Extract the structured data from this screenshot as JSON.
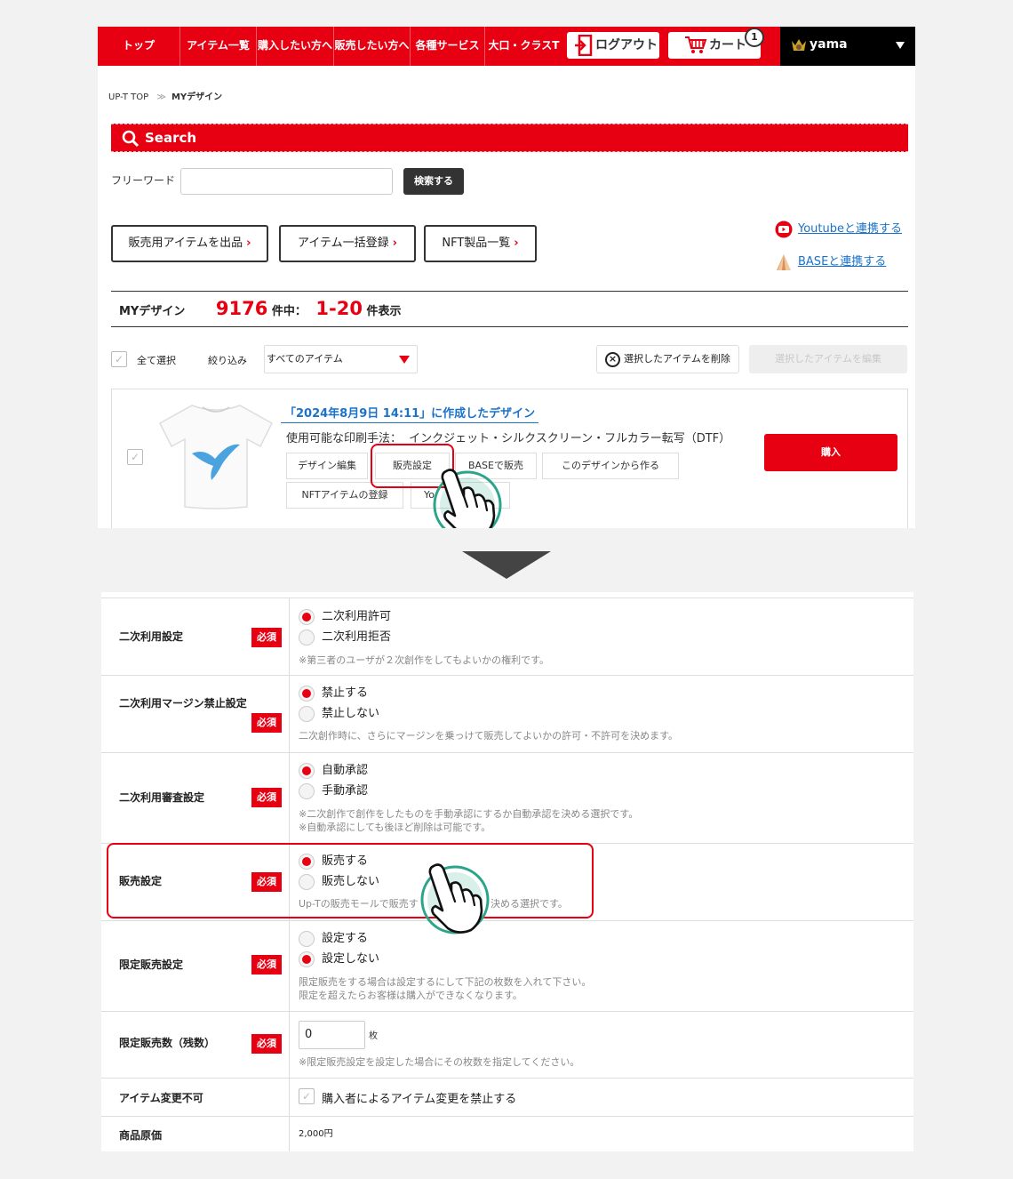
{
  "nav": {
    "items": [
      "トップ",
      "アイテム一覧",
      "購入したい方へ",
      "販売したい方へ",
      "各種サービス",
      "大口・クラスT"
    ],
    "logout_label": "ログアウト",
    "cart_label": "カート",
    "cart_count": "1",
    "username": "yama"
  },
  "breadcrumb": {
    "root": "UP-T TOP",
    "current": "MYデザイン"
  },
  "search": {
    "title": "Search",
    "freeword_label": "フリーワード",
    "freeword_value": "",
    "submit_label": "検索する"
  },
  "actions": [
    "販売用アイテムを出品",
    "アイテム一括登録",
    "NFT製品一覧"
  ],
  "links": {
    "youtube": "Youtubeと連携する",
    "base": "BASEと連携する"
  },
  "summary": {
    "title": "MYデザイン",
    "total": "9176",
    "total_suffix": "件中：",
    "range": "1-20",
    "range_suffix": "件表示"
  },
  "filters": {
    "select_all_label": "全て選択",
    "narrow_label": "絞り込み",
    "narrow_value": "すべてのアイテム",
    "delete_selected_label": "選択したアイテムを削除",
    "edit_selected_label": "選択したアイテムを編集"
  },
  "item": {
    "title": "「2024年8月9日 14:11」に作成したデザイン",
    "print_methods_label": "使用可能な印刷手法：",
    "print_methods": "インクジェット・シルクスクリーン・フルカラー転写（DTF）",
    "buttons": [
      "デザイン編集",
      "販売設定",
      "BASEで販売",
      "このデザインから作る",
      "NFTアイテムの登録",
      "Yo"
    ],
    "buy_label": "購入"
  },
  "form": {
    "required_label": "必須",
    "rows": [
      {
        "label": "二次利用設定",
        "options": [
          "二次利用許可",
          "二次利用拒否"
        ],
        "selected": 0,
        "notes": [
          "※第三者のユーザが２次創作をしてもよいかの権利です。"
        ]
      },
      {
        "label": "二次利用マージン禁止設定",
        "options": [
          "禁止する",
          "禁止しない"
        ],
        "selected": 0,
        "notes": [
          "二次創作時に、さらにマージンを乗っけて販売してよいかの許可・不許可を決めます。"
        ]
      },
      {
        "label": "二次利用審査設定",
        "options": [
          "自動承認",
          "手動承認"
        ],
        "selected": 0,
        "notes": [
          "※二次創作で創作をしたものを手動承認にするか自動承認を決める選択です。",
          "※自動承認にしても後ほど削除は可能です。"
        ]
      },
      {
        "label": "販売設定",
        "options": [
          "販売する",
          "販売しない"
        ],
        "selected": 0,
        "notes": [
          "Up-Tの販売モールで販売す",
          "決める選択です。"
        ]
      },
      {
        "label": "限定販売設定",
        "options": [
          "設定する",
          "設定しない"
        ],
        "selected": 1,
        "notes": [
          "限定販売をする場合は設定するにして下記の枚数を入れて下さい。",
          "限定を超えたらお客様は購入ができなくなります。"
        ]
      }
    ],
    "limit_count": {
      "label": "限定販売数（残数）",
      "value": "0",
      "unit": "枚",
      "note": "※限定販売設定を設定した場合にその枚数を指定してください。"
    },
    "no_change": {
      "label": "アイテム変更不可",
      "checkbox_label": "購入者によるアイテム変更を禁止する"
    },
    "cost": {
      "label": "商品原価",
      "value": "2,000円"
    }
  },
  "colors": {
    "brand_red": "#e60012",
    "link_blue": "#1a73c8",
    "pointer_teal": "#2aa58a"
  }
}
